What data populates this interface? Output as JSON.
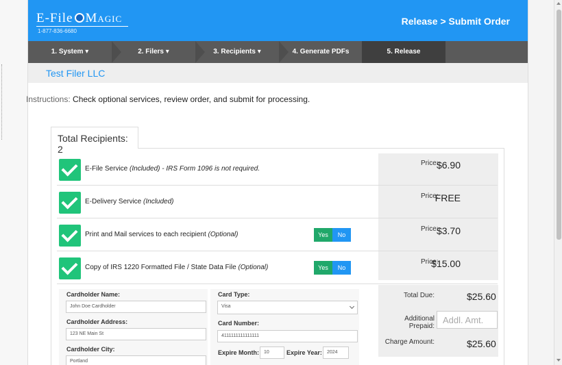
{
  "header": {
    "logo_left": "E-File",
    "logo_right": "Magic",
    "phone": "1-877-836-6680",
    "title": "Release > Submit Order"
  },
  "steps": [
    {
      "label": "1. System",
      "caret": "▾"
    },
    {
      "label": "2. Filers",
      "caret": "▾"
    },
    {
      "label": "3. Recipients",
      "caret": "▾"
    },
    {
      "label": "4. Generate PDFs",
      "caret": ""
    },
    {
      "label": "5. Release",
      "caret": ""
    }
  ],
  "filer_name": "Test Filer LLC",
  "instructions": {
    "label": "Instructions:",
    "text": "Check optional services, review order, and submit for processing."
  },
  "tab_label": "Total Recipients: 2",
  "services": [
    {
      "name": "E-File Service",
      "note": "(Included) - IRS Form 1096 is not required.",
      "price_label": "Price:",
      "price": "$6.90",
      "toggle": false
    },
    {
      "name": "E-Delivery Service",
      "note": "(Included)",
      "price_label": "Price:",
      "price": "FREE",
      "toggle": false
    },
    {
      "name": "Print and Mail services to each recipient",
      "note": "(Optional)",
      "price_label": "Price:",
      "price": "$3.70",
      "toggle": true
    },
    {
      "name": "Copy of IRS 1220 Formatted File / State Data File",
      "note": "(Optional)",
      "price_label": "Price:",
      "price": "$15.00",
      "toggle": true
    }
  ],
  "toggle": {
    "yes": "Yes",
    "no": "No"
  },
  "form": {
    "cardholder_name_label": "Cardholder Name:",
    "cardholder_name_value": "John Doe Cardholder",
    "cardholder_address_label": "Cardholder Address:",
    "cardholder_address_value": "123 NE Main St",
    "cardholder_city_label": "Cardholder City:",
    "cardholder_city_value": "Portland",
    "card_type_label": "Card Type:",
    "card_type_value": "Visa",
    "card_number_label": "Card Number:",
    "card_number_value": "4111111111111111",
    "expire_month_label": "Expire Month:",
    "expire_month_value": "10",
    "expire_year_label": "Expire Year:",
    "expire_year_value": "2024"
  },
  "totals": {
    "total_due_label": "Total Due:",
    "total_due_value": "$25.60",
    "additional_prepaid_label_1": "Additional",
    "additional_prepaid_label_2": "Prepaid:",
    "additional_placeholder": "Addl. Amt.",
    "charge_amount_label": "Charge Amount:",
    "charge_amount_value": "$25.60"
  },
  "colors": {
    "brand_blue": "#2196f3",
    "check_green": "#20c47a",
    "nav_gray": "#5a5a5a"
  }
}
